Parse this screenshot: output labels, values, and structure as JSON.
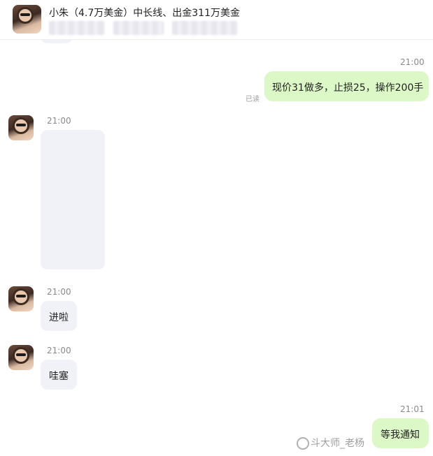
{
  "header": {
    "title": "小朱（4.7万美金）中长线、出金311万美金",
    "avatar": "contact-avatar"
  },
  "messages": [
    {
      "time": "21:00",
      "side": "out",
      "text": "现价31做多，止损25，操作200手",
      "status": "已读"
    },
    {
      "time": "21:00",
      "side": "in",
      "type": "image"
    },
    {
      "time": "21:00",
      "side": "in",
      "text": "进啦"
    },
    {
      "time": "21:00",
      "side": "in",
      "text": "哇塞"
    },
    {
      "time": "21:01",
      "side": "out",
      "text": "等我通知"
    }
  ],
  "watermark": "斗大师_老杨",
  "colors": {
    "outgoing_bubble": "#dcf8c6",
    "incoming_bubble": "#f1f2f7",
    "timestamp": "#8a8a8a"
  }
}
